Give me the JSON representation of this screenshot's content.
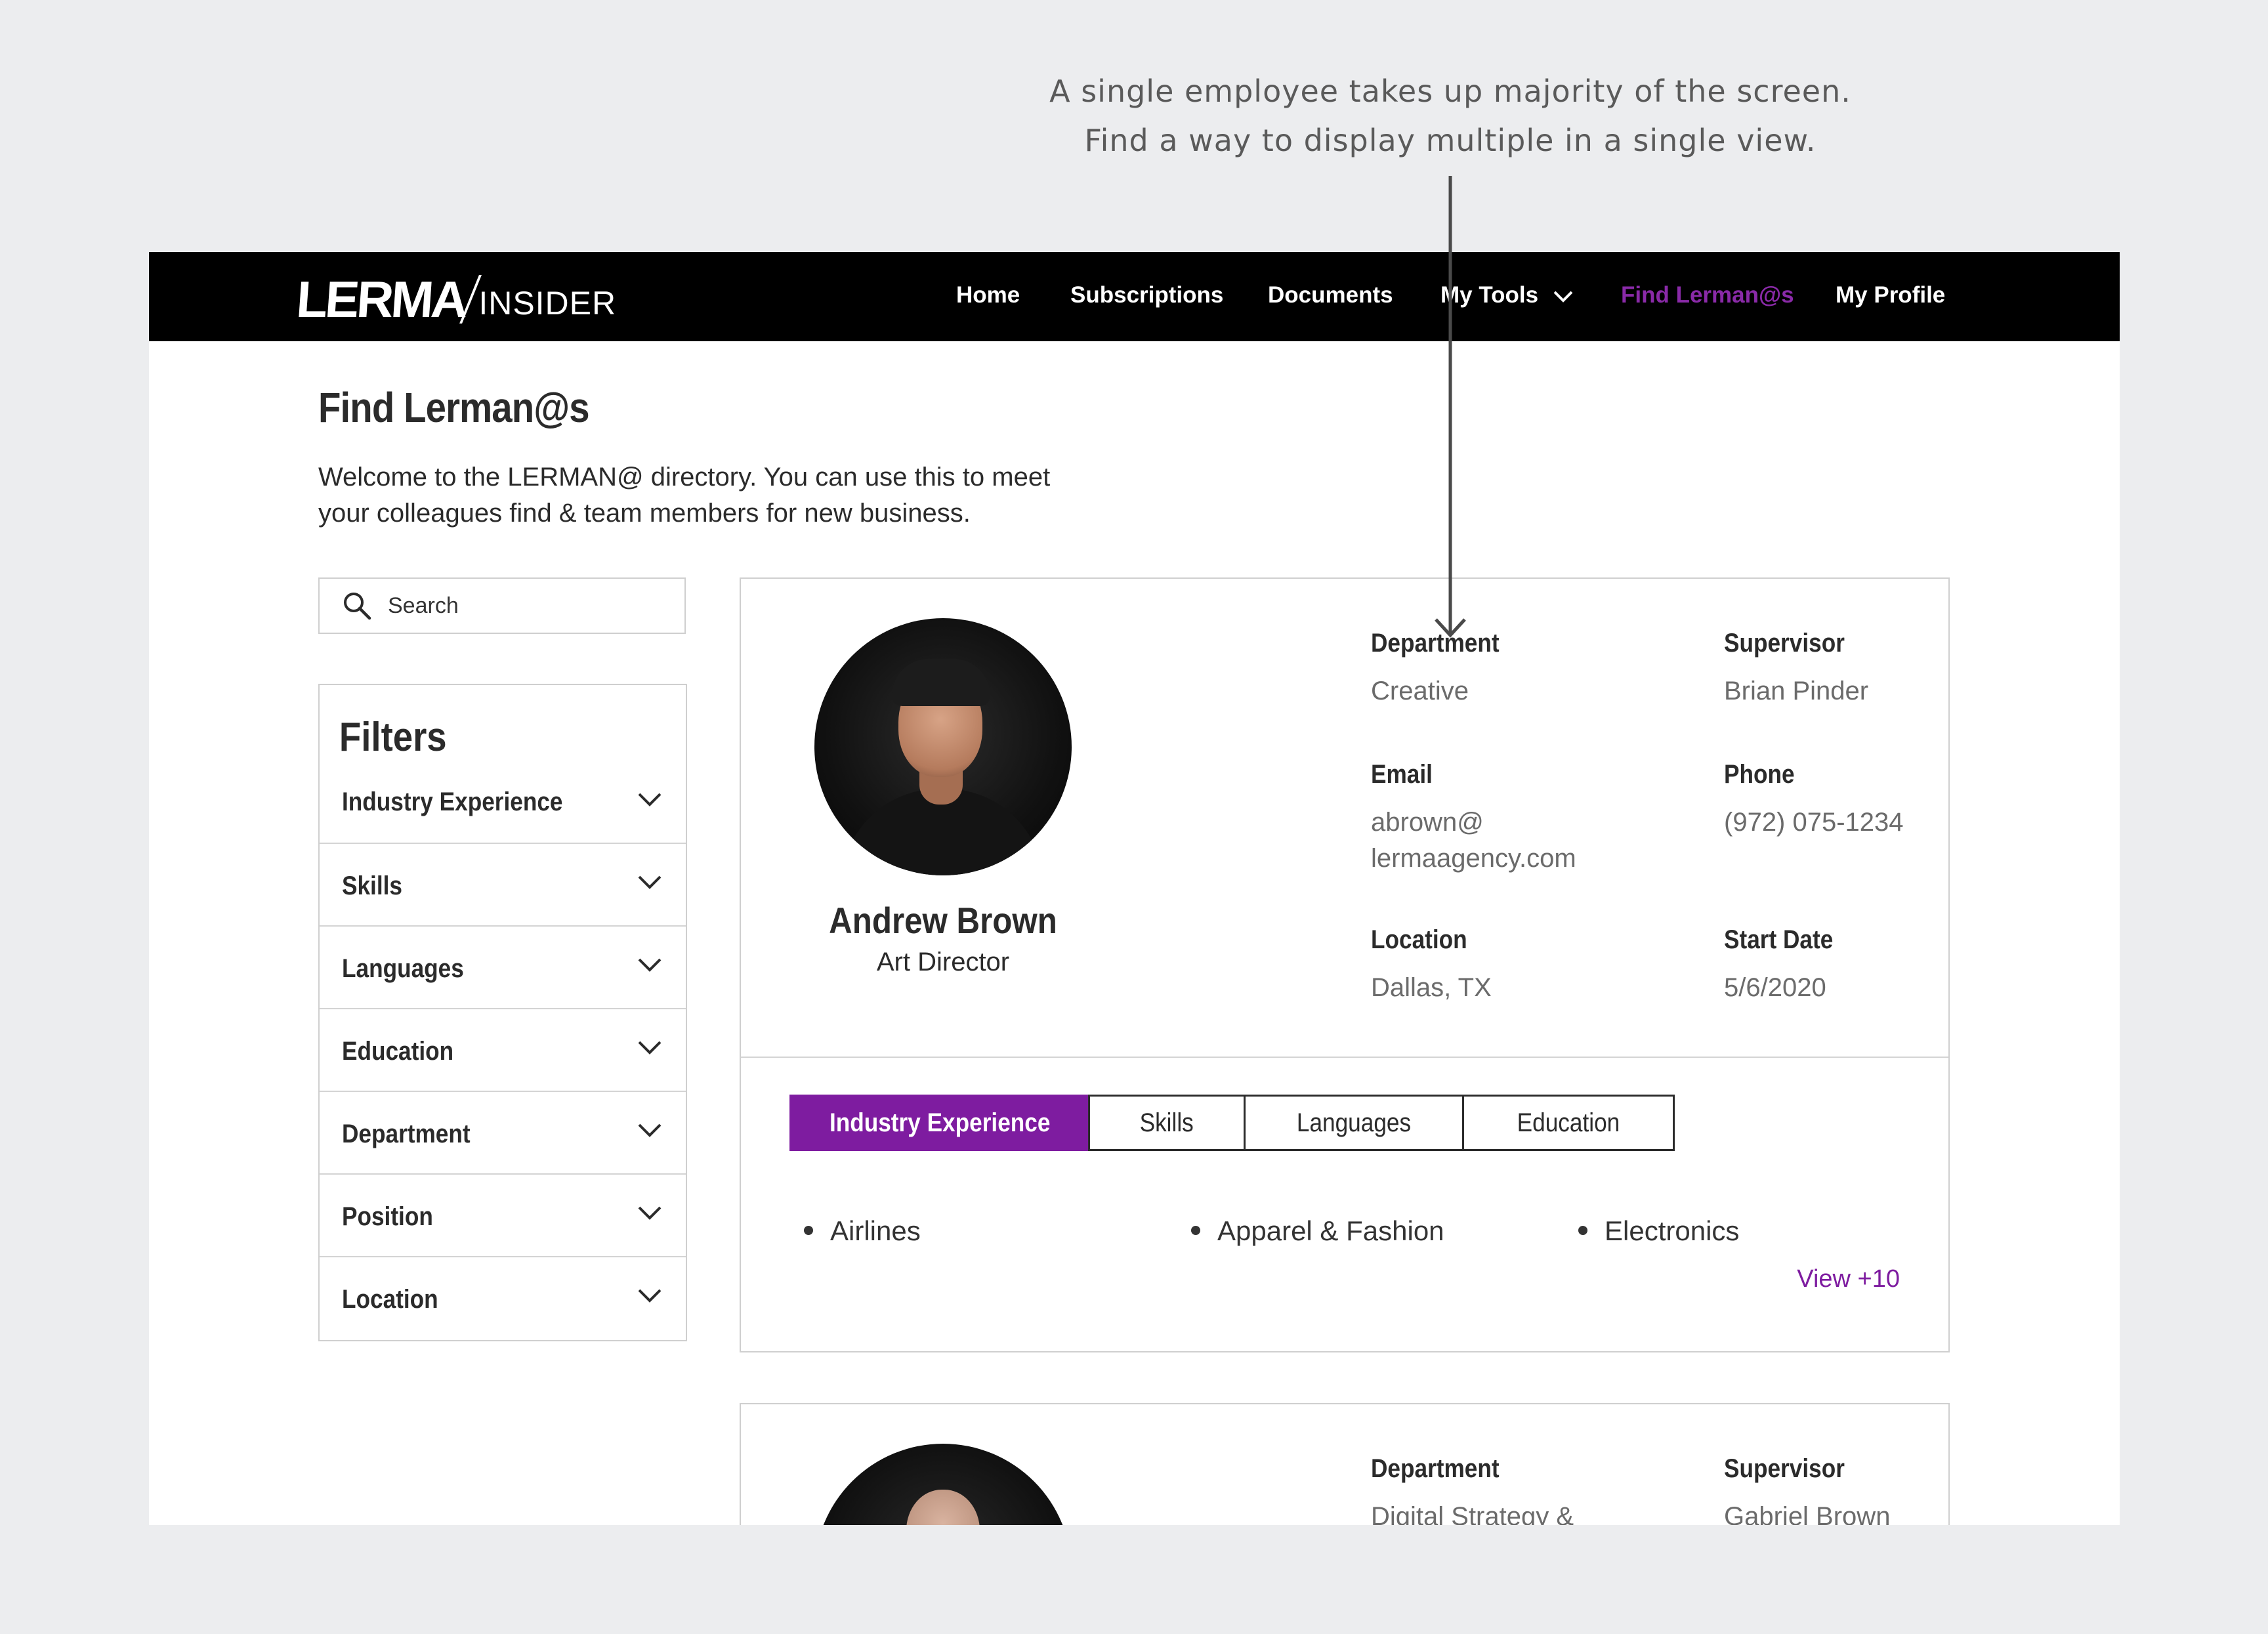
{
  "annotation": {
    "line1": "A single employee takes up majority of the screen.",
    "line2": "Find a way to display multiple in a single view."
  },
  "nav": {
    "logo_mark": "LERMA",
    "logo_sub": "INSIDER",
    "home": "Home",
    "subscriptions": "Subscriptions",
    "documents": "Documents",
    "my_tools": "My Tools",
    "find": "Find Lerman@s",
    "profile": "My Profile",
    "active_color": "#8a2aa8"
  },
  "page": {
    "title": "Find Lerman@s",
    "intro_line1": "Welcome to the LERMAN@ directory. You can use this to meet",
    "intro_line2": "your colleagues find & team members for new business."
  },
  "search": {
    "placeholder": "Search"
  },
  "filters": {
    "title": "Filters",
    "items": [
      "Industry Experience",
      "Skills",
      "Languages",
      "Education",
      "Department",
      "Position",
      "Location"
    ]
  },
  "employees": [
    {
      "name": "Andrew Brown",
      "title": "Art Director",
      "fields": {
        "department_label": "Department",
        "department": "Creative",
        "supervisor_label": "Supervisor",
        "supervisor": "Brian Pinder",
        "email_label": "Email",
        "email_line1": "abrown@",
        "email_line2": "lermaagency.com",
        "phone_label": "Phone",
        "phone": "(972) 075-1234",
        "location_label": "Location",
        "location": "Dallas, TX",
        "start_label": "Start Date",
        "start": "5/6/2020"
      },
      "tabs": [
        "Industry Experience",
        "Skills",
        "Languages",
        "Education"
      ],
      "active_tab": "Industry Experience",
      "experience": [
        "Airlines",
        "Apparel & Fashion",
        "Electronics"
      ],
      "view_more": "View +10"
    },
    {
      "fields": {
        "department_label": "Department",
        "department": "Digital Strategy &",
        "supervisor_label": "Supervisor",
        "supervisor": "Gabriel Brown"
      }
    }
  ],
  "colors": {
    "accent": "#7e1ca0",
    "background": "#ecedef",
    "navbar": "#000000"
  }
}
